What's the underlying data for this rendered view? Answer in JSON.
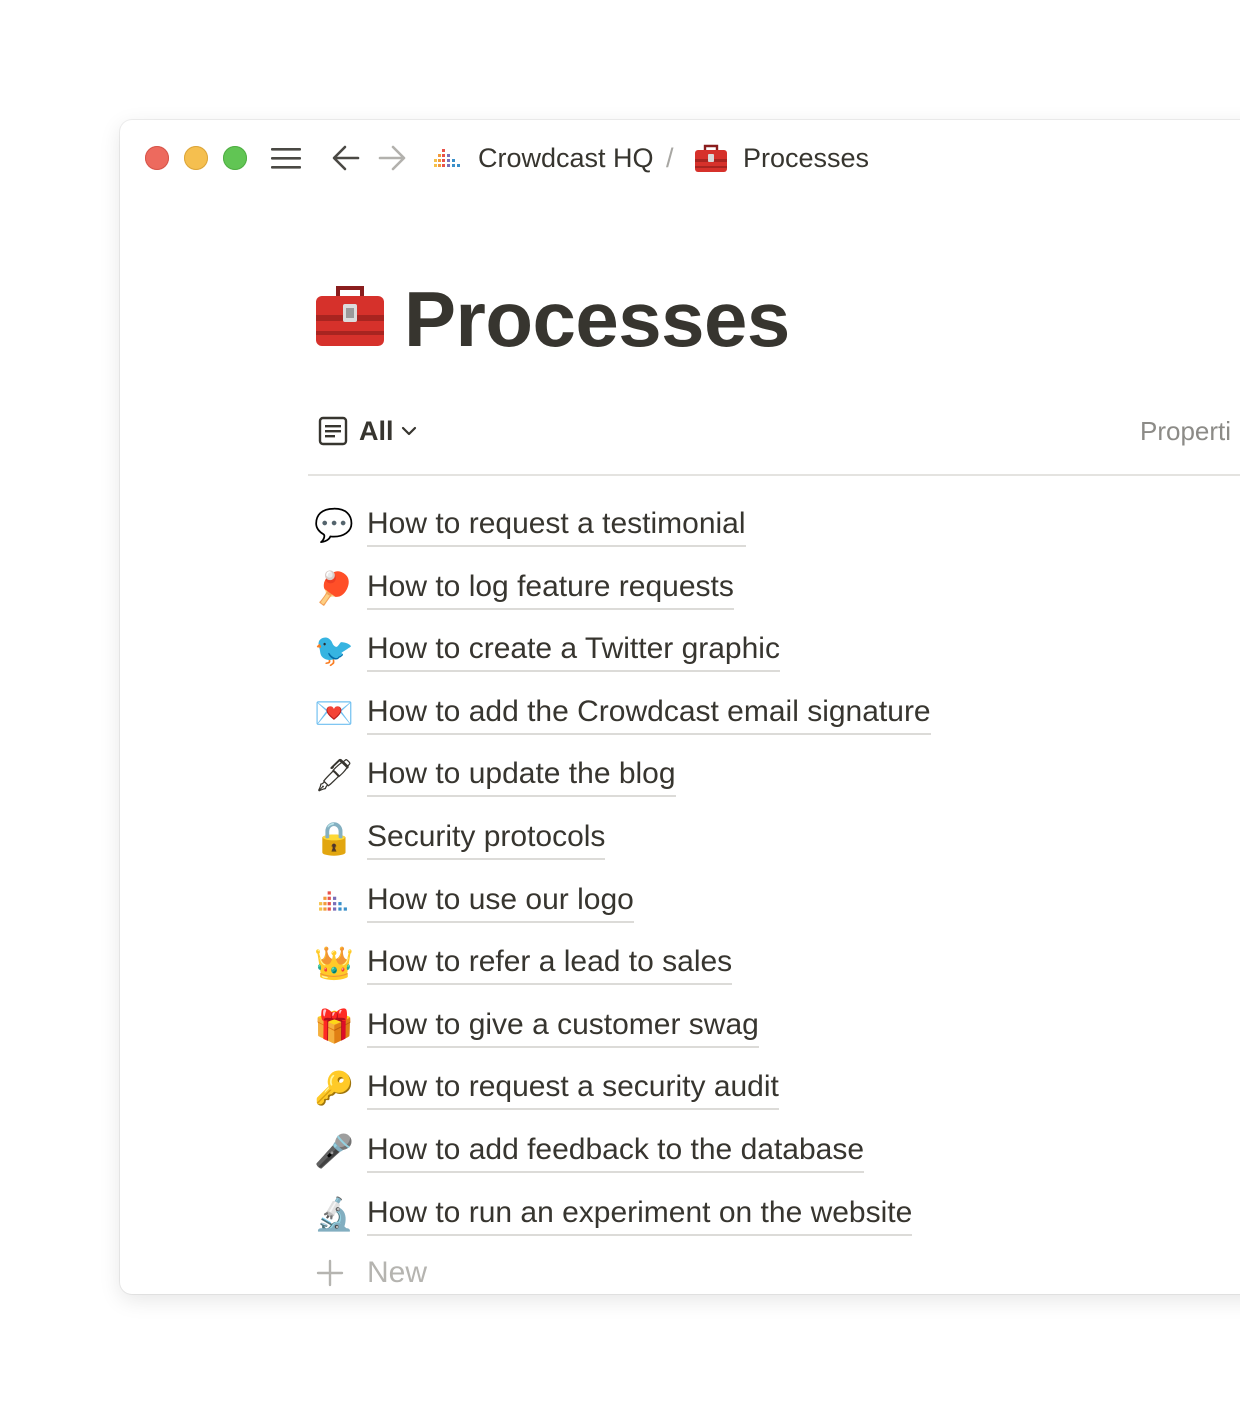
{
  "breadcrumb": {
    "workspace": "Crowdcast HQ",
    "separator": "/",
    "page": "Processes"
  },
  "page": {
    "title": "Processes",
    "icon": "toolbox-icon"
  },
  "view": {
    "label": "All",
    "properties_label": "Properti"
  },
  "items": [
    {
      "label": "How to request a testimonial",
      "icon": "speech-bubble-icon"
    },
    {
      "label": "How to log feature requests",
      "icon": "ping-pong-icon"
    },
    {
      "label": "How to create a Twitter graphic",
      "icon": "bird-icon"
    },
    {
      "label": "How to add the Crowdcast email signature",
      "icon": "love-letter-icon"
    },
    {
      "label": "How to update the blog",
      "icon": "pen-icon"
    },
    {
      "label": "Security protocols",
      "icon": "padlock-icon"
    },
    {
      "label": "How to use our logo",
      "icon": "crowdcast-logo-icon"
    },
    {
      "label": "How to refer a lead to sales",
      "icon": "crown-icon"
    },
    {
      "label": "How to give a customer swag",
      "icon": "gift-icon"
    },
    {
      "label": "How to request a security audit",
      "icon": "key-icon"
    },
    {
      "label": "How to add feedback to the database",
      "icon": "microphone-icon"
    },
    {
      "label": "How to run an experiment on the website",
      "icon": "microscope-icon"
    }
  ],
  "new_row": {
    "label": "New"
  },
  "colors": {
    "text": "#37352f",
    "muted": "#8c8b87",
    "close": "#ed6a5e",
    "minimize": "#f5bf4f",
    "zoom": "#61c554"
  }
}
